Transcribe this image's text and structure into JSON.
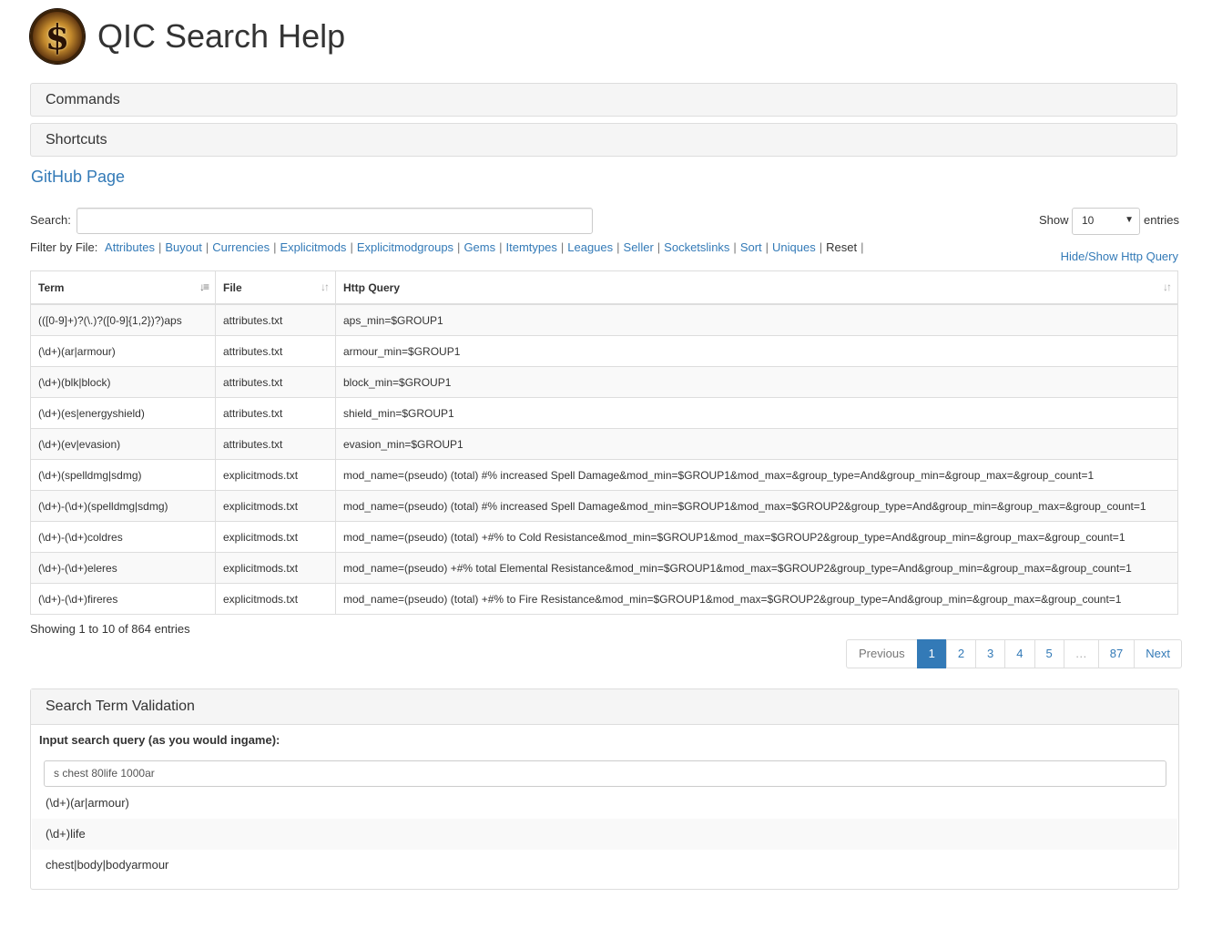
{
  "header": {
    "title": "QIC Search Help",
    "logo_symbol": "$"
  },
  "panels": {
    "commands": "Commands",
    "shortcuts": "Shortcuts"
  },
  "github_link": "GitHub Page",
  "search": {
    "label": "Search:",
    "value": ""
  },
  "length": {
    "show": "Show",
    "value": "10",
    "entries": "entries"
  },
  "filter": {
    "label": "Filter by File:",
    "items": [
      "Attributes",
      "Buyout",
      "Currencies",
      "Explicitmods",
      "Explicitmodgroups",
      "Gems",
      "Itemtypes",
      "Leagues",
      "Seller",
      "Socketslinks",
      "Sort",
      "Uniques"
    ],
    "reset": "Reset"
  },
  "hide_show": "Hide/Show Http Query",
  "table": {
    "columns": [
      "Term",
      "File",
      "Http Query"
    ],
    "rows": [
      [
        "(([0-9]+)?(\\.)?([0-9]{1,2})?)aps",
        "attributes.txt",
        "aps_min=$GROUP1"
      ],
      [
        "(\\d+)(ar|armour)",
        "attributes.txt",
        "armour_min=$GROUP1"
      ],
      [
        "(\\d+)(blk|block)",
        "attributes.txt",
        "block_min=$GROUP1"
      ],
      [
        "(\\d+)(es|energyshield)",
        "attributes.txt",
        "shield_min=$GROUP1"
      ],
      [
        "(\\d+)(ev|evasion)",
        "attributes.txt",
        "evasion_min=$GROUP1"
      ],
      [
        "(\\d+)(spelldmg|sdmg)",
        "explicitmods.txt",
        "mod_name=(pseudo) (total) #% increased Spell Damage&mod_min=$GROUP1&mod_max=&group_type=And&group_min=&group_max=&group_count=1"
      ],
      [
        "(\\d+)-(\\d+)(spelldmg|sdmg)",
        "explicitmods.txt",
        "mod_name=(pseudo) (total) #% increased Spell Damage&mod_min=$GROUP1&mod_max=$GROUP2&group_type=And&group_min=&group_max=&group_count=1"
      ],
      [
        "(\\d+)-(\\d+)coldres",
        "explicitmods.txt",
        "mod_name=(pseudo) (total) +#% to Cold Resistance&mod_min=$GROUP1&mod_max=$GROUP2&group_type=And&group_min=&group_max=&group_count=1"
      ],
      [
        "(\\d+)-(\\d+)eleres",
        "explicitmods.txt",
        "mod_name=(pseudo) +#% total Elemental Resistance&mod_min=$GROUP1&mod_max=$GROUP2&group_type=And&group_min=&group_max=&group_count=1"
      ],
      [
        "(\\d+)-(\\d+)fireres",
        "explicitmods.txt",
        "mod_name=(pseudo) (total) +#% to Fire Resistance&mod_min=$GROUP1&mod_max=$GROUP2&group_type=And&group_min=&group_max=&group_count=1"
      ]
    ]
  },
  "info": "Showing 1 to 10 of 864 entries",
  "pagination": [
    "Previous",
    "1",
    "2",
    "3",
    "4",
    "5",
    "…",
    "87",
    "Next"
  ],
  "validation": {
    "title": "Search Term Validation",
    "label": "Input search query (as you would ingame):",
    "input_value": "s chest 80life 1000ar",
    "results": [
      "(\\d+)(ar|armour)",
      "(\\d+)life",
      "chest|body|bodyarmour"
    ]
  }
}
